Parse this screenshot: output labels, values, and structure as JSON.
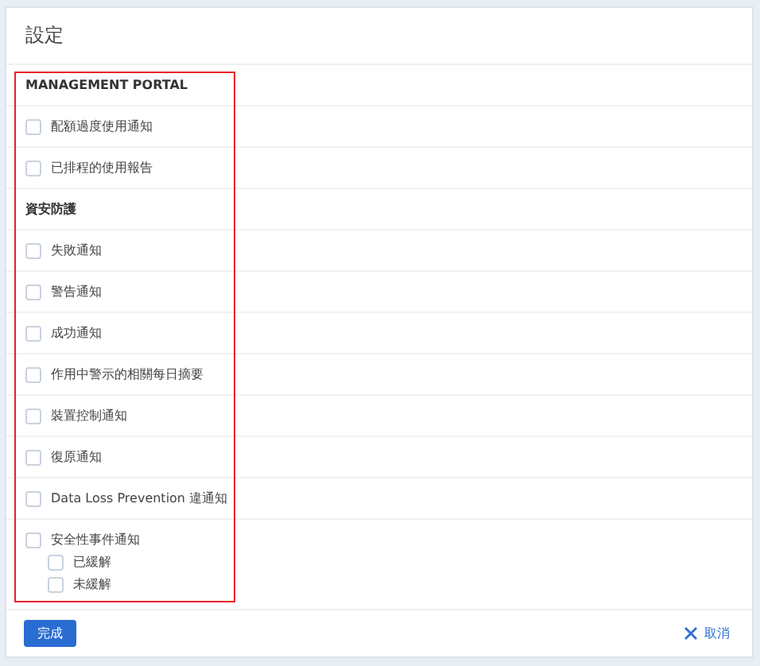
{
  "dialog": {
    "title": "設定"
  },
  "sections": [
    {
      "heading": "MANAGEMENT PORTAL",
      "items": [
        {
          "label": "配額過度使用通知",
          "checked": false
        },
        {
          "label": "已排程的使用報告",
          "checked": false
        }
      ]
    },
    {
      "heading": "資安防護",
      "items": [
        {
          "label": "失敗通知",
          "checked": false
        },
        {
          "label": "警告通知",
          "checked": false
        },
        {
          "label": "成功通知",
          "checked": false
        },
        {
          "label": "作用中警示的相關每日摘要",
          "checked": false
        },
        {
          "label": "裝置控制通知",
          "checked": false
        },
        {
          "label": "復原通知",
          "checked": false
        },
        {
          "label": "Data Loss Prevention 違通知",
          "checked": false
        },
        {
          "label": "安全性事件通知",
          "checked": false,
          "children": [
            {
              "label": "已緩解",
              "checked": false
            },
            {
              "label": "未緩解",
              "checked": false
            }
          ]
        }
      ]
    }
  ],
  "footer": {
    "done_button": "完成",
    "cancel_button": "取消"
  }
}
